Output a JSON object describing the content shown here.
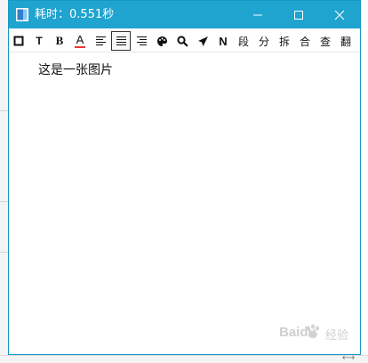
{
  "window": {
    "title": "耗时：0.551秒"
  },
  "toolbar": {
    "items": [
      {
        "name": "frame-icon",
        "label": ""
      },
      {
        "name": "text-tool",
        "label": "T"
      },
      {
        "name": "bold-tool",
        "label": "B"
      },
      {
        "name": "font-color-tool",
        "label": "A"
      },
      {
        "name": "align-left-icon",
        "label": ""
      },
      {
        "name": "align-justify-icon",
        "label": ""
      },
      {
        "name": "align-right-icon",
        "label": ""
      },
      {
        "name": "palette-icon",
        "label": ""
      },
      {
        "name": "search-icon",
        "label": ""
      },
      {
        "name": "send-icon",
        "label": ""
      },
      {
        "name": "normal-tool",
        "label": "N"
      },
      {
        "name": "paragraph-tool",
        "label": "段"
      },
      {
        "name": "split-tool",
        "label": "分"
      },
      {
        "name": "break-tool",
        "label": "拆"
      },
      {
        "name": "merge-tool",
        "label": "合"
      },
      {
        "name": "lookup-tool",
        "label": "查"
      },
      {
        "name": "translate-tool",
        "label": "翻"
      }
    ]
  },
  "content": {
    "text": "这是一张图片"
  },
  "colors": {
    "titlebar": "#1fa3cf",
    "font_color_underline": "#e53935"
  },
  "watermark": {
    "brand": "Baidu",
    "sub": "经验"
  }
}
